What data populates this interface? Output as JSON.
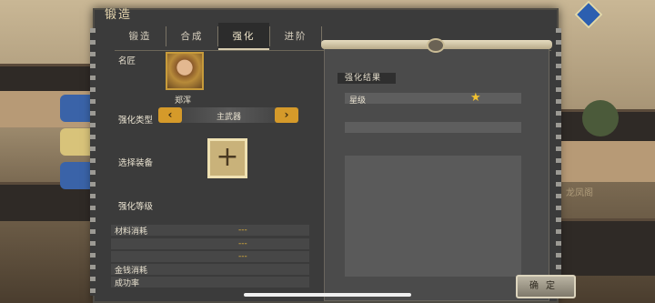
{
  "window_title": "锻造",
  "tabs": [
    {
      "label": "锻造",
      "active": false
    },
    {
      "label": "合成",
      "active": false
    },
    {
      "label": "强化",
      "active": true
    },
    {
      "label": "进阶",
      "active": false
    }
  ],
  "form": {
    "smith_label": "名匠",
    "smith_name": "郑浑",
    "enhance_type_label": "强化类型",
    "enhance_type_value": "主武器",
    "select_equip_label": "选择装备",
    "enhance_level_label": "强化等级",
    "material_cost_label": "材料消耗",
    "material_rows": [
      "---",
      "---",
      "---"
    ],
    "gold_cost_label": "金钱消耗",
    "success_rate_label": "成功率"
  },
  "result": {
    "header": "强化结果",
    "star_level_label": "星级",
    "stars": 1
  },
  "buttons": {
    "confirm": "确定",
    "prev": "‹",
    "next": "›",
    "add": "+"
  },
  "scene": {
    "map_label": "龙凤阁"
  },
  "colors": {
    "accent": "#d59a2a",
    "panel": "#3b3b3b",
    "value_text": "#e0b23a"
  }
}
